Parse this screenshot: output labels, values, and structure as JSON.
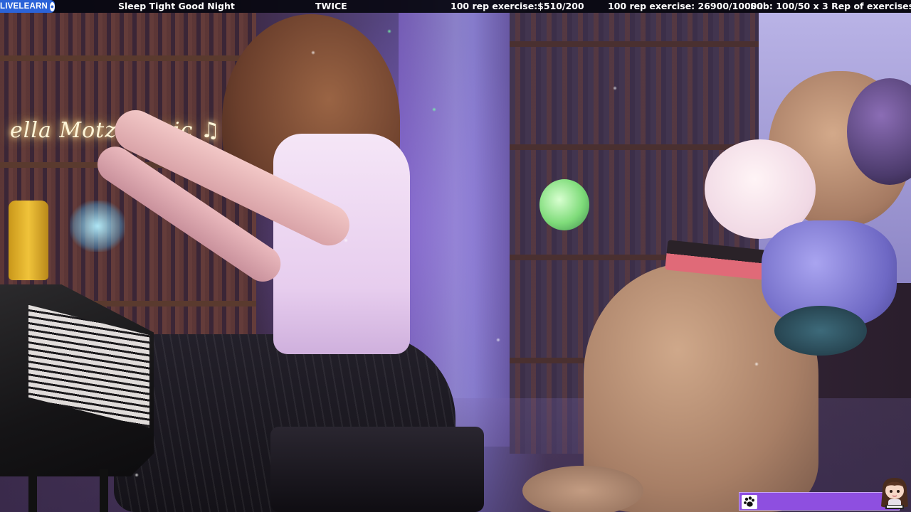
{
  "overlay": {
    "logo": {
      "text": "LIVELEARN",
      "icon": "paw-icon",
      "color": "#2b63d8"
    },
    "now_playing": {
      "song": "Sleep Tight Good Night",
      "artist": "TWICE"
    },
    "goals": [
      {
        "text": "100 rep exercise:$510/200"
      },
      {
        "text": "100 rep exercise: 26900/10000"
      },
      {
        "text": "Sub: 100/50 x 3 Rep of exercises"
      }
    ]
  },
  "bottom_widget": {
    "icon": "paw-icon",
    "progress_fraction": 1.0,
    "bar_color": "#8e4fe0",
    "avatar_icon": "chibi-avatar-icon"
  }
}
